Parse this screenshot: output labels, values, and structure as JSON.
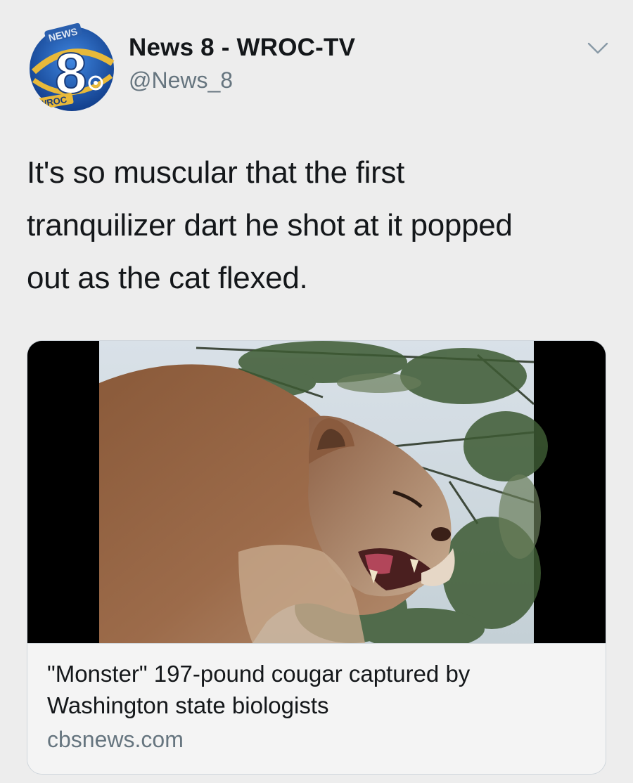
{
  "tweet": {
    "author": {
      "display_name": "News 8 - WROC-TV",
      "handle": "@News_8",
      "avatar_text": {
        "top": "NEWS",
        "number": "8",
        "bottom": "WROC"
      }
    },
    "menu_icon": "chevron-down-icon",
    "text_lines": [
      "It's so muscular that the first",
      "tranquilizer dart he shot at it popped",
      "out as the cat flexed."
    ],
    "card": {
      "image_icon": "cougar-photo",
      "title_lines": [
        "\"Monster\" 197-pound cougar captured by",
        "Washington state biologists"
      ],
      "domain": "cbsnews.com"
    }
  },
  "colors": {
    "background": "#ededed",
    "text": "#14171a",
    "secondary": "#66757f",
    "card_border": "#cfd6dc",
    "avatar_blue": "#1e5bb5",
    "avatar_gold": "#e8b93a"
  }
}
